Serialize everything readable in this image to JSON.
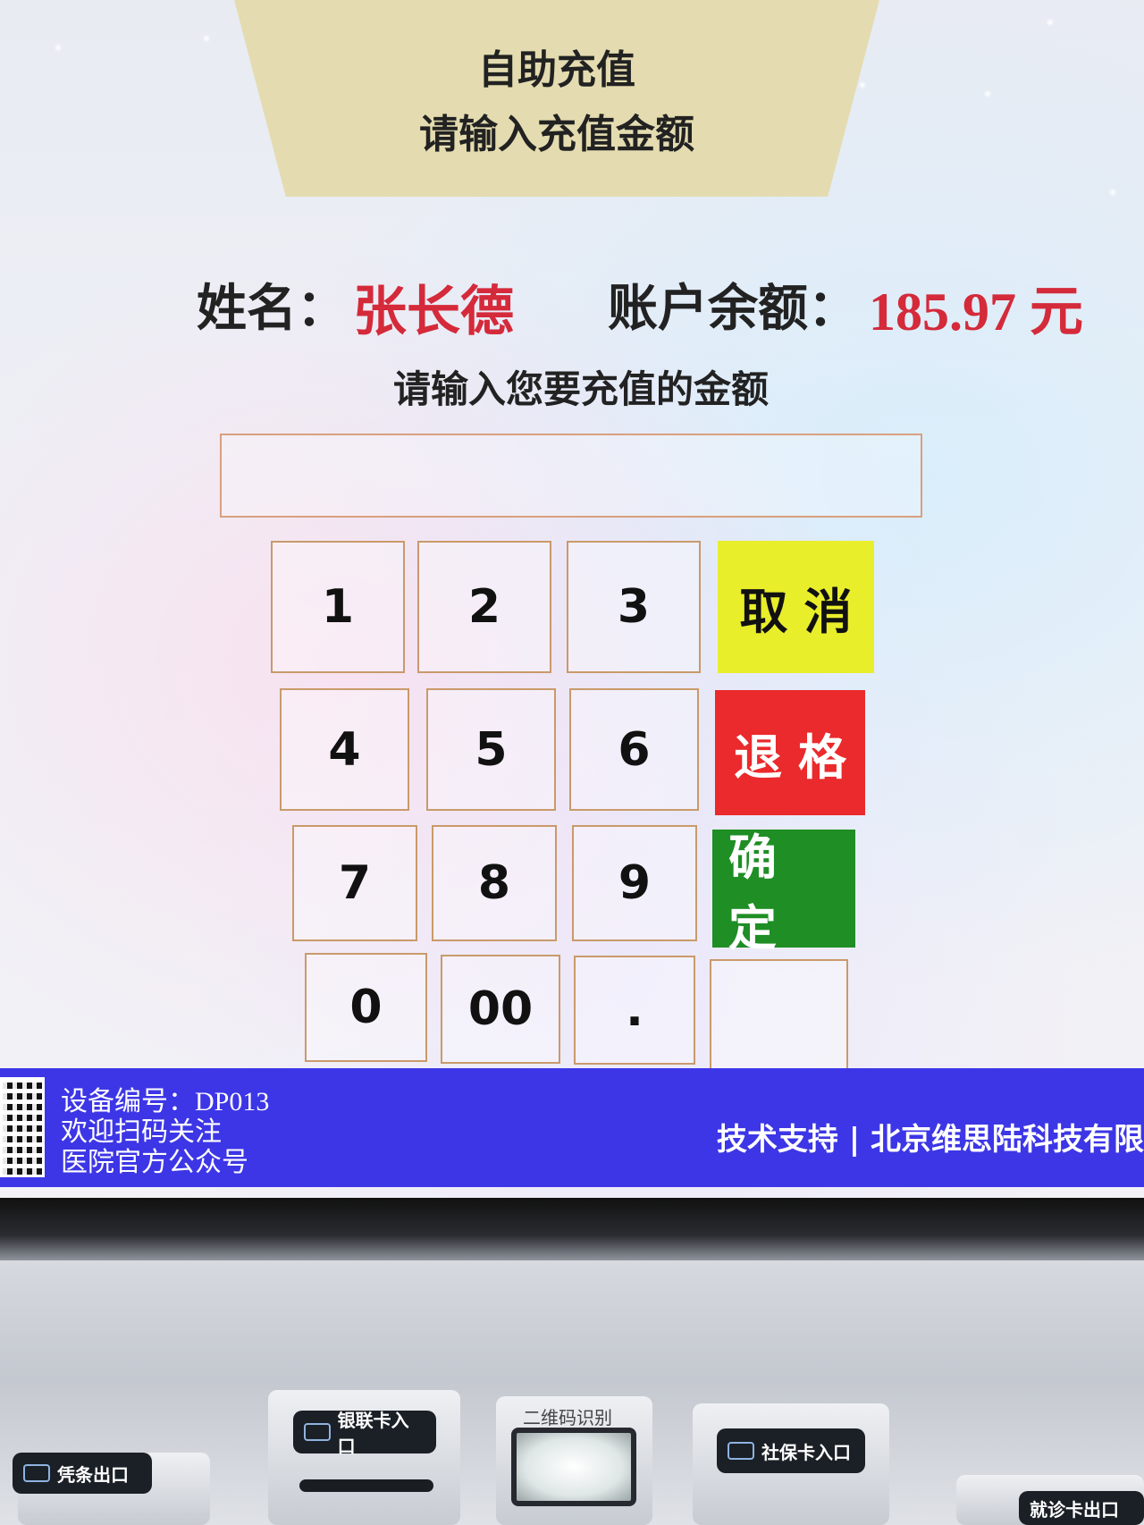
{
  "header": {
    "title": "自助充值",
    "subtitle": "请输入充值金额"
  },
  "account": {
    "name_label": "姓名：",
    "name": "张长德",
    "balance_label": "账户余额：",
    "balance": "185.97 元"
  },
  "amount": {
    "prompt": "请输入您要充值的金额",
    "value": ""
  },
  "keypad": {
    "keys": [
      "1",
      "2",
      "3",
      "4",
      "5",
      "6",
      "7",
      "8",
      "9",
      "0",
      "00",
      "."
    ],
    "cancel": "取消",
    "backspace": "退格",
    "confirm": "确定"
  },
  "footer": {
    "device": "设备编号：DP013",
    "follow_line1": "欢迎扫码关注",
    "follow_line2": "医院官方公众号",
    "support": "技术支持 | 北京维思陆科技有限"
  },
  "kiosk": {
    "receipt_exit": "凭条出口",
    "bank_card": "银联卡入口",
    "qr_scan": "二维码识别",
    "social_card": "社保卡入口",
    "visit_card": "就诊卡出口"
  },
  "colors": {
    "cancel": "#e9ee2b",
    "backspace": "#ea2a2c",
    "confirm": "#1f8e25",
    "footer": "#3d36e6",
    "highlight_text": "#d42a3a"
  }
}
